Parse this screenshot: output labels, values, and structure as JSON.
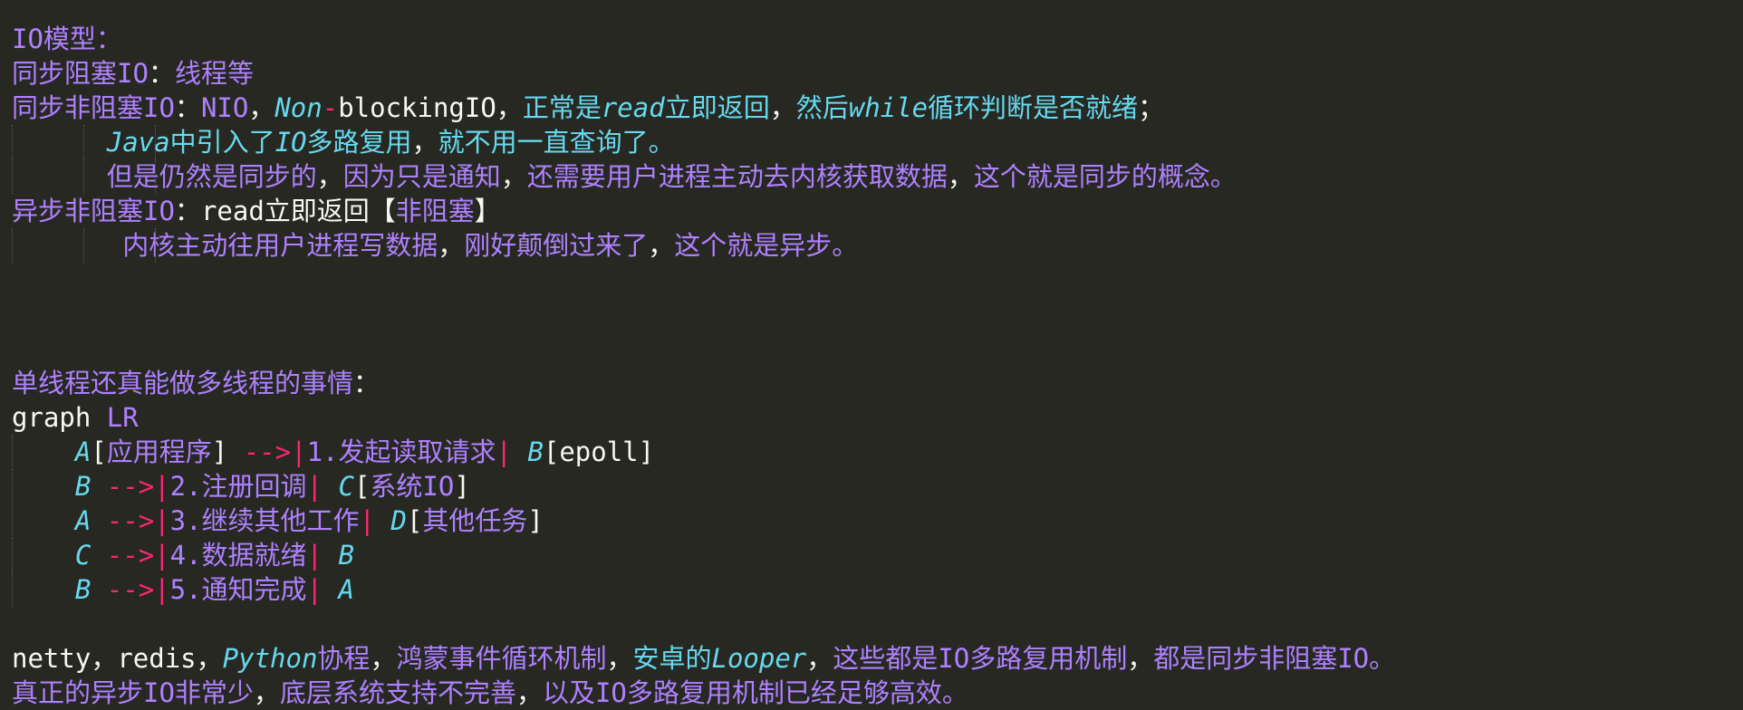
{
  "editor": {
    "lines": [
      {
        "id": "io-model-title",
        "guides": 0,
        "tokens": [
          {
            "t": "IO模型：",
            "s": "p"
          }
        ]
      },
      {
        "id": "sync-blocking",
        "guides": 0,
        "tokens": [
          {
            "t": "同步阻塞IO",
            "s": "p"
          },
          {
            "t": "：",
            "s": "w"
          },
          {
            "t": "线程等",
            "s": "p"
          }
        ]
      },
      {
        "id": "sync-nonblocking",
        "guides": 0,
        "tokens": [
          {
            "t": "同步非阻塞IO",
            "s": "p"
          },
          {
            "t": "：",
            "s": "w"
          },
          {
            "t": "NIO",
            "s": "p"
          },
          {
            "t": "，",
            "s": "w"
          },
          {
            "t": "Non",
            "s": "ci"
          },
          {
            "t": "-",
            "s": "r"
          },
          {
            "t": "blockingIO",
            "s": "w"
          },
          {
            "t": "，",
            "s": "w"
          },
          {
            "t": "正常是",
            "s": "c"
          },
          {
            "t": "read",
            "s": "ci"
          },
          {
            "t": "立即返回",
            "s": "c"
          },
          {
            "t": "，",
            "s": "w"
          },
          {
            "t": "然后",
            "s": "c"
          },
          {
            "t": "while",
            "s": "ci"
          },
          {
            "t": "循环判断是否就绪",
            "s": "c"
          },
          {
            "t": "；",
            "s": "w"
          }
        ]
      },
      {
        "id": "sync-nonblocking-java",
        "guides": 3,
        "tokens": [
          {
            "t": "      ",
            "s": "w"
          },
          {
            "t": "Java",
            "s": "ci"
          },
          {
            "t": "中引入了",
            "s": "c"
          },
          {
            "t": "IO",
            "s": "ci"
          },
          {
            "t": "多路复用",
            "s": "c"
          },
          {
            "t": "，",
            "s": "w"
          },
          {
            "t": "就不用一直查询了。",
            "s": "c"
          }
        ]
      },
      {
        "id": "sync-nonblocking-still-sync",
        "guides": 3,
        "tokens": [
          {
            "t": "      ",
            "s": "w"
          },
          {
            "t": "但是仍然是同步的",
            "s": "p"
          },
          {
            "t": "，",
            "s": "w"
          },
          {
            "t": "因为只是通知",
            "s": "p"
          },
          {
            "t": "，",
            "s": "w"
          },
          {
            "t": "还需要用户进程主动去内核获取数据",
            "s": "p"
          },
          {
            "t": "，",
            "s": "w"
          },
          {
            "t": "这个就是同步的概念。",
            "s": "p"
          }
        ]
      },
      {
        "id": "async-nonblocking",
        "guides": 0,
        "tokens": [
          {
            "t": "异步非阻塞IO",
            "s": "p"
          },
          {
            "t": "：",
            "s": "w"
          },
          {
            "t": "read立即返回【",
            "s": "w"
          },
          {
            "t": "非阻塞",
            "s": "p"
          },
          {
            "t": "】",
            "s": "w"
          }
        ]
      },
      {
        "id": "async-nonblocking-kernel",
        "guides": 3,
        "tokens": [
          {
            "t": "       ",
            "s": "w"
          },
          {
            "t": "内核主动往用户进程写数据",
            "s": "p"
          },
          {
            "t": "，",
            "s": "w"
          },
          {
            "t": "刚好颠倒过来了",
            "s": "p"
          },
          {
            "t": "，",
            "s": "w"
          },
          {
            "t": "这个就是异步。",
            "s": "p"
          }
        ]
      },
      {
        "id": "blank-1",
        "guides": 0,
        "tokens": []
      },
      {
        "id": "blank-2",
        "guides": 0,
        "tokens": []
      },
      {
        "id": "blank-3",
        "guides": 0,
        "tokens": []
      },
      {
        "id": "single-thread-title",
        "guides": 0,
        "tokens": [
          {
            "t": "单线程还真能做多线程的事情",
            "s": "p"
          },
          {
            "t": "：",
            "s": "w"
          }
        ]
      },
      {
        "id": "graph-header",
        "guides": 0,
        "tokens": [
          {
            "t": "graph ",
            "s": "w"
          },
          {
            "t": "LR",
            "s": "p"
          }
        ]
      },
      {
        "id": "graph-edge-1",
        "guides": 1,
        "tokens": [
          {
            "t": "    ",
            "s": "w"
          },
          {
            "t": "A",
            "s": "ci"
          },
          {
            "t": "[",
            "s": "w"
          },
          {
            "t": "应用程序",
            "s": "p"
          },
          {
            "t": "] ",
            "s": "w"
          },
          {
            "t": "-->|",
            "s": "r"
          },
          {
            "t": "1.发起读取请求",
            "s": "p"
          },
          {
            "t": "| ",
            "s": "r"
          },
          {
            "t": "B",
            "s": "ci"
          },
          {
            "t": "[epoll]",
            "s": "w"
          }
        ]
      },
      {
        "id": "graph-edge-2",
        "guides": 1,
        "tokens": [
          {
            "t": "    ",
            "s": "w"
          },
          {
            "t": "B",
            "s": "ci"
          },
          {
            "t": " ",
            "s": "w"
          },
          {
            "t": "-->|",
            "s": "r"
          },
          {
            "t": "2.注册回调",
            "s": "p"
          },
          {
            "t": "| ",
            "s": "r"
          },
          {
            "t": "C",
            "s": "ci"
          },
          {
            "t": "[",
            "s": "w"
          },
          {
            "t": "系统IO",
            "s": "p"
          },
          {
            "t": "]",
            "s": "w"
          }
        ]
      },
      {
        "id": "graph-edge-3",
        "guides": 1,
        "tokens": [
          {
            "t": "    ",
            "s": "w"
          },
          {
            "t": "A",
            "s": "ci"
          },
          {
            "t": " ",
            "s": "w"
          },
          {
            "t": "-->|",
            "s": "r"
          },
          {
            "t": "3.继续其他工作",
            "s": "p"
          },
          {
            "t": "| ",
            "s": "r"
          },
          {
            "t": "D",
            "s": "ci"
          },
          {
            "t": "[",
            "s": "w"
          },
          {
            "t": "其他任务",
            "s": "p"
          },
          {
            "t": "]",
            "s": "w"
          }
        ]
      },
      {
        "id": "graph-edge-4",
        "guides": 1,
        "tokens": [
          {
            "t": "    ",
            "s": "w"
          },
          {
            "t": "C",
            "s": "ci"
          },
          {
            "t": " ",
            "s": "w"
          },
          {
            "t": "-->|",
            "s": "r"
          },
          {
            "t": "4.数据就绪",
            "s": "p"
          },
          {
            "t": "| ",
            "s": "r"
          },
          {
            "t": "B",
            "s": "ci"
          }
        ]
      },
      {
        "id": "graph-edge-5",
        "guides": 1,
        "tokens": [
          {
            "t": "    ",
            "s": "w"
          },
          {
            "t": "B",
            "s": "ci"
          },
          {
            "t": " ",
            "s": "w"
          },
          {
            "t": "-->|",
            "s": "r"
          },
          {
            "t": "5.通知完成",
            "s": "p"
          },
          {
            "t": "| ",
            "s": "r"
          },
          {
            "t": "A",
            "s": "ci"
          }
        ]
      },
      {
        "id": "blank-4",
        "guides": 0,
        "tokens": []
      },
      {
        "id": "iomux-examples",
        "guides": 0,
        "tokens": [
          {
            "t": "netty",
            "s": "w"
          },
          {
            "t": "，",
            "s": "w"
          },
          {
            "t": "redis",
            "s": "w"
          },
          {
            "t": "，",
            "s": "w"
          },
          {
            "t": "Python",
            "s": "ci"
          },
          {
            "t": "协程",
            "s": "p"
          },
          {
            "t": "，",
            "s": "w"
          },
          {
            "t": "鸿蒙事件循环机制",
            "s": "p"
          },
          {
            "t": "，",
            "s": "w"
          },
          {
            "t": "安卓的",
            "s": "c"
          },
          {
            "t": "Looper",
            "s": "ci"
          },
          {
            "t": "，",
            "s": "w"
          },
          {
            "t": "这些都是IO多路复用机制",
            "s": "p"
          },
          {
            "t": "，",
            "s": "w"
          },
          {
            "t": "都是同步非阻塞IO。",
            "s": "p"
          }
        ]
      },
      {
        "id": "true-async-rare",
        "guides": 0,
        "tokens": [
          {
            "t": "真正的异步IO非常少",
            "s": "p"
          },
          {
            "t": "，",
            "s": "w"
          },
          {
            "t": "底层系统支持不完善",
            "s": "p"
          },
          {
            "t": "，",
            "s": "w"
          },
          {
            "t": "以及IO多路复用机制已经足够高效。",
            "s": "p"
          }
        ]
      }
    ]
  }
}
